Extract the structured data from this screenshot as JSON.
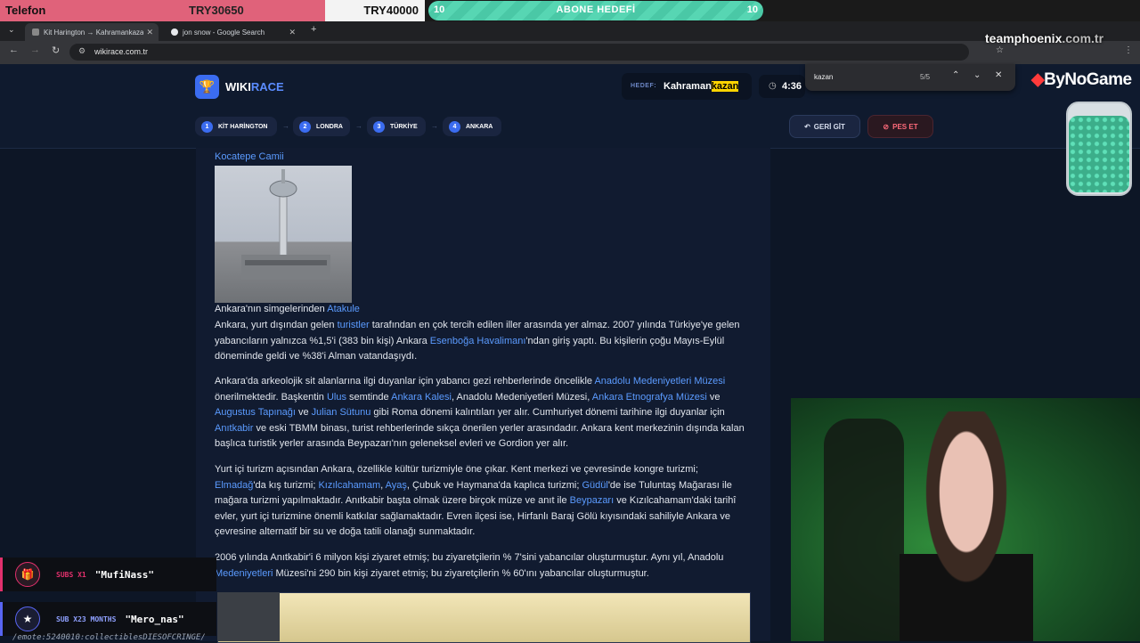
{
  "overlay": {
    "donation_label": "Telefon",
    "donation_amount_1": "TRY30650",
    "donation_amount_2": "TRY40000",
    "sub_goal_left": "10",
    "sub_goal_title": "ABONE HEDEFİ",
    "sub_goal_right": "10",
    "domain_bold": "teamphoenix",
    "domain_rest": ".com.tr",
    "sponsor": "ByNoGame",
    "alerts": [
      {
        "kind": "SUBS X1",
        "user": "\"MufiNass\""
      },
      {
        "kind": "SUB X23 MONTHS",
        "user": "\"Mero_nas\""
      }
    ],
    "emote_text": "/emote:5240010:collectiblesDIESOFCRINGE/"
  },
  "browser": {
    "tabs": [
      {
        "label": "Kit Harington → Kahramankazan"
      },
      {
        "label": "jon snow - Google Search"
      }
    ],
    "url": "wikirace.com.tr",
    "find": {
      "query": "kazan",
      "count": "5/5"
    }
  },
  "site": {
    "logo_a": "WIKI",
    "logo_b": "RACE",
    "target_label": "HEDEF:",
    "target_a": "Kahraman",
    "target_b": "kazan",
    "timer": "4:36",
    "breadcrumbs": [
      {
        "n": "1",
        "label": "KİT HARİNGTON"
      },
      {
        "n": "2",
        "label": "LONDRA"
      },
      {
        "n": "3",
        "label": "TÜRKİYE"
      },
      {
        "n": "4",
        "label": "ANKARA"
      }
    ],
    "back_label": "GERİ GİT",
    "give_up_label": "PES ET"
  },
  "article": {
    "top_caption": "Kocatepe Camii",
    "img_caption_a": "Ankara'nın simgelerinden ",
    "img_caption_link": "Atakule"
  }
}
